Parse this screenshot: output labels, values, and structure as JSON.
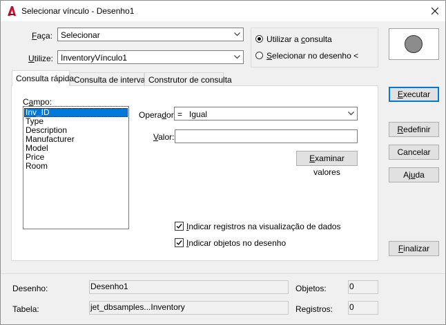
{
  "window": {
    "title": "Selecionar vínculo - Desenho1",
    "accent": "#c8102e"
  },
  "form": {
    "faca_label_u": "F",
    "faca_label_rest": "aça:",
    "faca_value": "Selecionar",
    "utilize_label_pre": "U",
    "utilize_label_rest": "tilize:",
    "utilize_value": "InventoryVínculo1"
  },
  "mode": {
    "usar_consulta_pre": "Utilizar a ",
    "usar_consulta_u": "c",
    "usar_consulta_rest": "onsulta",
    "selecionar_u": "S",
    "selecionar_rest": "elecionar no desenho <",
    "selected": "usar_consulta"
  },
  "tabs": [
    {
      "label": "Consulta rápida",
      "active": true
    },
    {
      "label": "Consulta de intervalo",
      "active": false
    },
    {
      "label": "Construtor de consulta",
      "active": false
    }
  ],
  "query": {
    "campo_label_pre": "C",
    "campo_label_u": "a",
    "campo_label_rest": "mpo:",
    "fields": [
      "Inv_ID",
      "Type",
      "Description",
      "Manufacturer",
      "Model",
      "Price",
      "Room"
    ],
    "selected_field": "Inv_ID",
    "operador_label_pre": "Opera",
    "operador_label_u": "d",
    "operador_label_rest": "or:",
    "operador_value": "=   Igual",
    "valor_label_u": "V",
    "valor_label_rest": "alor:",
    "valor_value": "",
    "examinar_u": "E",
    "examinar_rest": "xaminar valores",
    "check_visualizacao_u": "I",
    "check_visualizacao_rest": "ndicar registros na visualização de dados",
    "check_visualizacao": true,
    "check_desenho_u": "I",
    "check_desenho_rest": "ndicar objetos no desenho",
    "check_desenho": true
  },
  "buttons": {
    "executar_u": "E",
    "executar_rest": "xecutar",
    "redefinir_u": "R",
    "redefinir_rest": "edefinir",
    "cancelar": "Cancelar",
    "ajuda_pre": "Aj",
    "ajuda_u": "u",
    "ajuda_rest": "da",
    "finalizar_u": "F",
    "finalizar_rest": "inalizar"
  },
  "status": {
    "desenho_label": "Desenho:",
    "desenho_value": "Desenho1",
    "objetos_label": "Objetos:",
    "objetos_value": "0",
    "tabela_label": "Tabela:",
    "tabela_value": "jet_dbsamples...Inventory",
    "registros_label": "Registros:",
    "registros_value": "0"
  },
  "icons": {
    "app": "autocad-a-icon",
    "close": "close-icon",
    "dropdown": "chevron-down-icon",
    "check": "checkmark-icon"
  }
}
